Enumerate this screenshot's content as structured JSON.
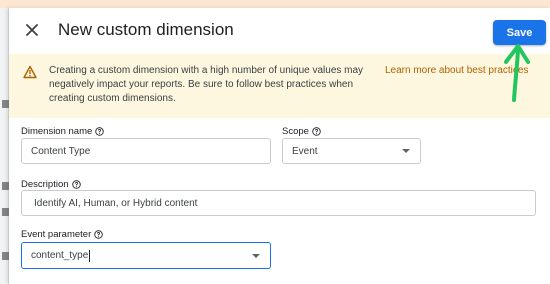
{
  "dialog": {
    "title": "New custom dimension",
    "save_label": "Save"
  },
  "warning": {
    "text": "Creating a custom dimension with a high number of unique values may negatively impact your reports. Be sure to follow best practices when creating custom dimensions.",
    "link": "Learn more about best practices"
  },
  "form": {
    "dimension_name": {
      "label": "Dimension name",
      "value": "Content Type"
    },
    "scope": {
      "label": "Scope",
      "value": "Event"
    },
    "description": {
      "label": "Description",
      "value": "Identify AI, Human, or Hybrid content"
    },
    "event_parameter": {
      "label": "Event parameter",
      "value": "content_type"
    }
  },
  "colors": {
    "accent": "#1a73e8",
    "warning_bg": "#fef7e0",
    "link": "#b06000",
    "annotation_arrow": "#22c55e"
  },
  "icons": [
    "close-icon",
    "warning-icon",
    "help-icon",
    "dropdown-arrow-icon",
    "annotation-arrow-icon"
  ]
}
